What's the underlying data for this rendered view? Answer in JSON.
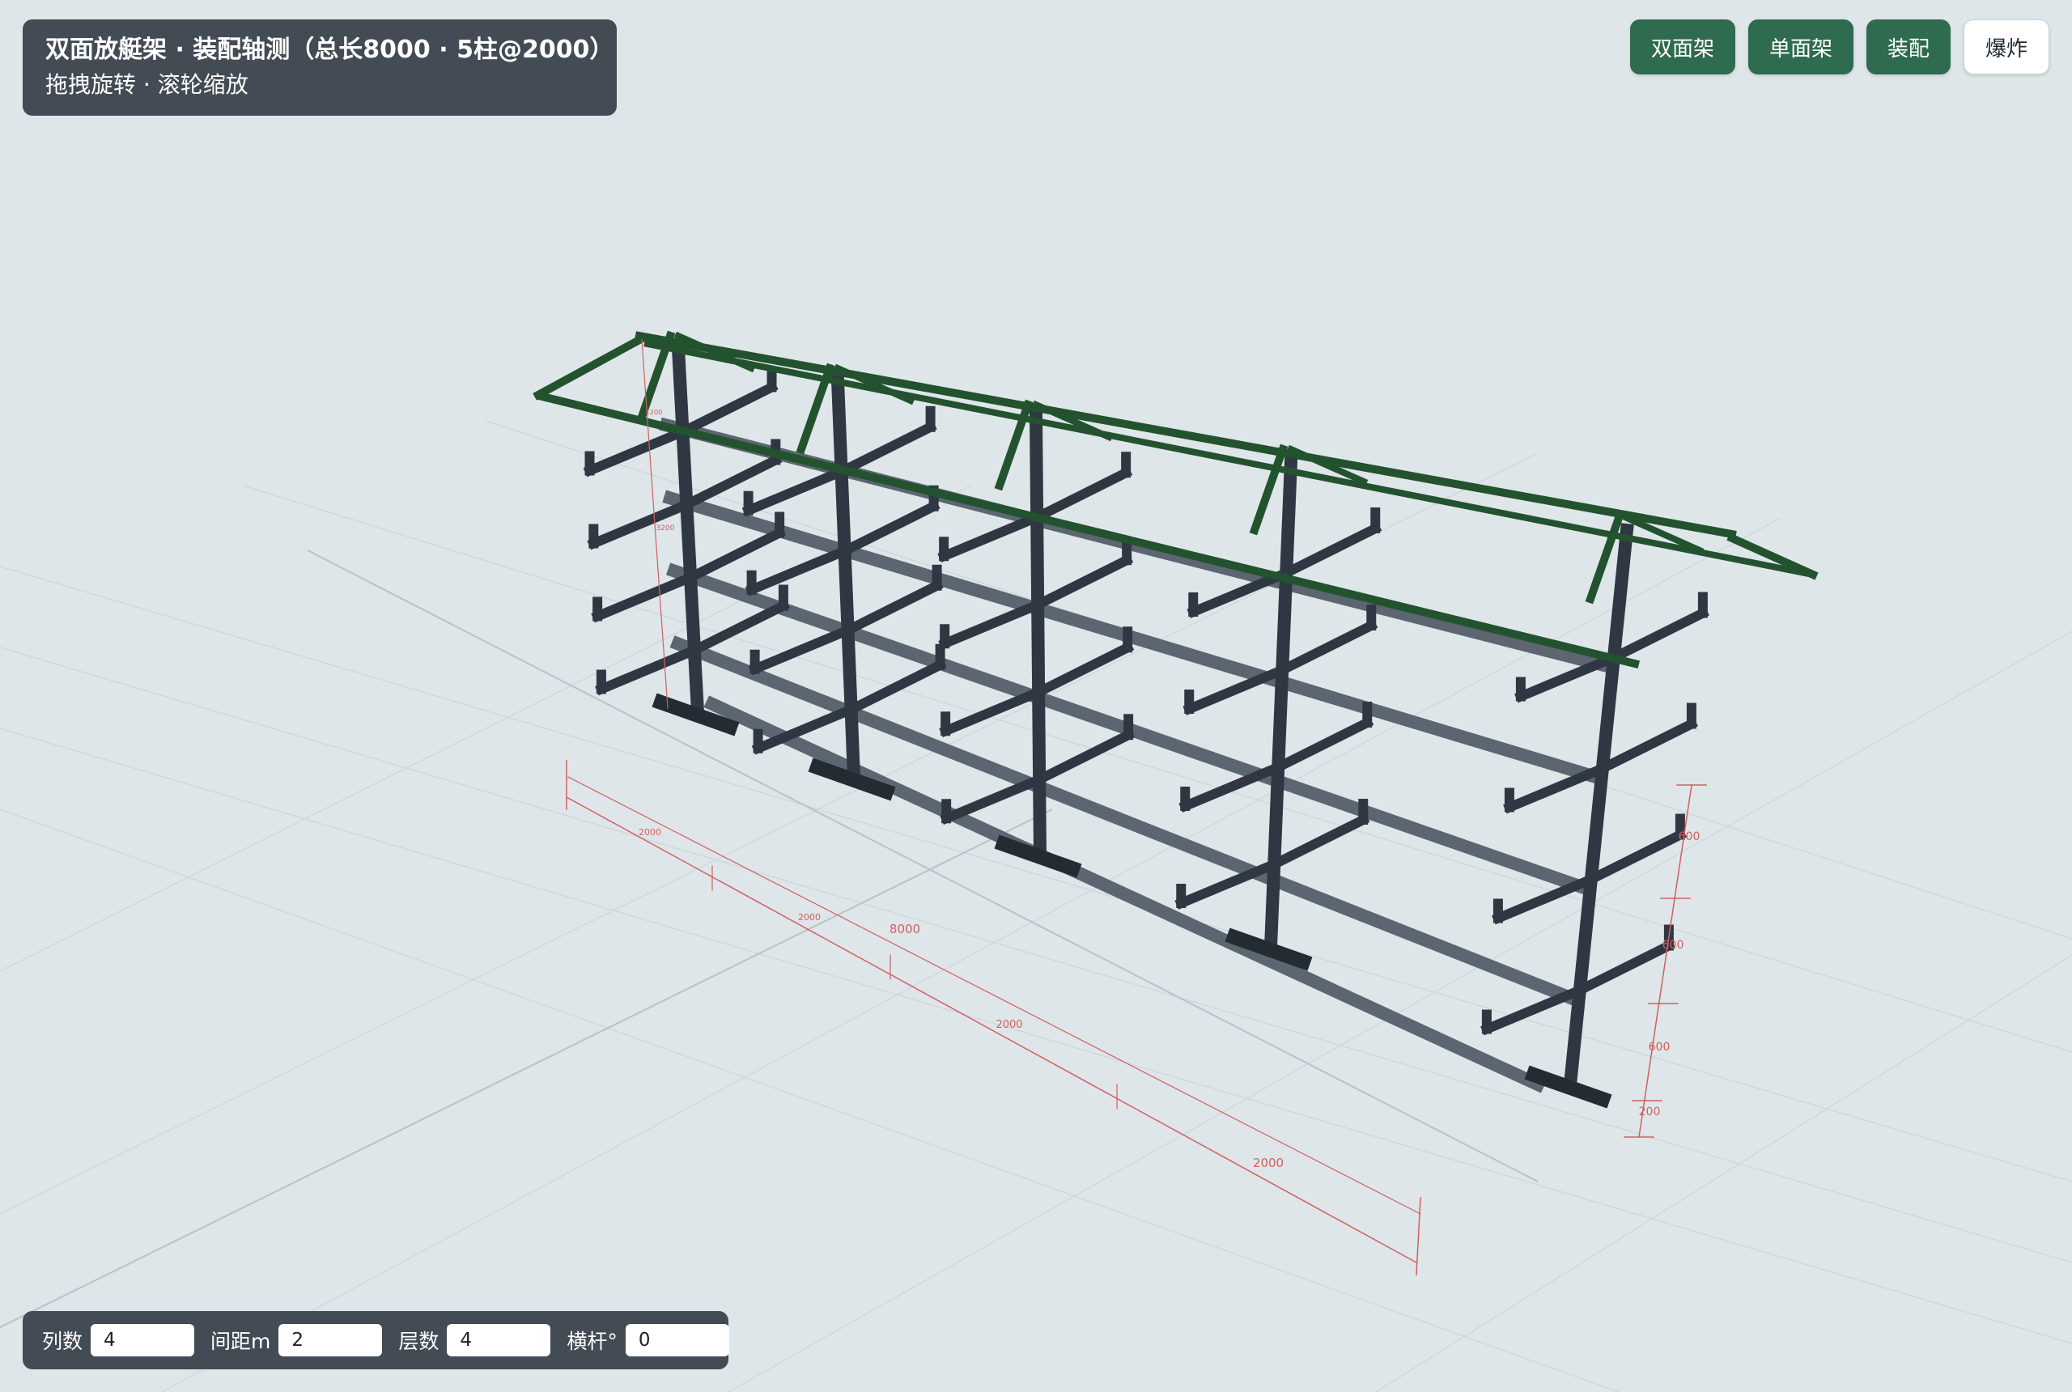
{
  "header": {
    "title": "双面放艇架 · 装配轴测（总长8000 · 5柱@2000）",
    "subtitle": "拖拽旋转 · 滚轮缩放"
  },
  "toolbar": {
    "buttons": [
      {
        "label": "双面架",
        "active": true
      },
      {
        "label": "单面架",
        "active": true
      },
      {
        "label": "装配",
        "active": true
      },
      {
        "label": "爆炸",
        "active": false
      }
    ]
  },
  "params": {
    "columns": {
      "label": "列数",
      "value": "4"
    },
    "spacing": {
      "label": "间距m",
      "value": "2"
    },
    "layers": {
      "label": "层数",
      "value": "4"
    },
    "bar_angle": {
      "label": "横杆°",
      "value": "0"
    }
  },
  "dimensions": {
    "total_length": "8000",
    "spans": [
      "2000",
      "2000",
      "2000",
      "2000"
    ],
    "height_total": "3200",
    "roof_height": "1200",
    "level_spacings": [
      "600",
      "600",
      "600",
      "200"
    ]
  },
  "colors": {
    "background": "#dfe6e9",
    "steel": "#2f3842",
    "steel_light": "#5b6670",
    "roof": "#23522f",
    "dimension": "#d06060",
    "button": "#2f6b4f",
    "panel": "#434b55"
  }
}
